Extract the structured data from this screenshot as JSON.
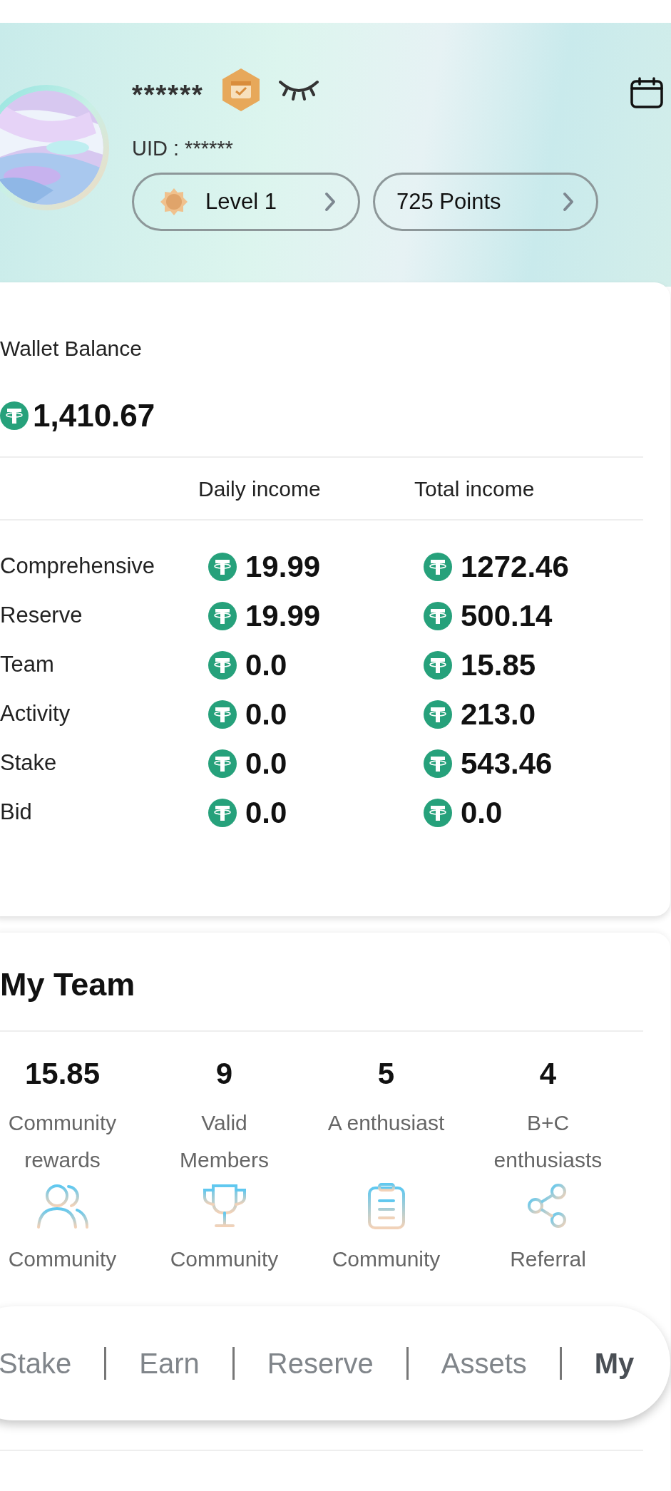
{
  "profile": {
    "name": "******",
    "uid": "UID : ******",
    "level": "Level 1",
    "points": "725 Points"
  },
  "wallet": {
    "title": "Wallet Balance",
    "balance": "1,410.67",
    "columns": [
      "Daily income",
      "Total income"
    ],
    "rows": [
      {
        "label": "Comprehensive",
        "daily": "19.99",
        "total": "1272.46"
      },
      {
        "label": "Reserve",
        "daily": "19.99",
        "total": "500.14"
      },
      {
        "label": "Team",
        "daily": "0.0",
        "total": "15.85"
      },
      {
        "label": "Activity",
        "daily": "0.0",
        "total": "213.0"
      },
      {
        "label": "Stake",
        "daily": "0.0",
        "total": "543.46"
      },
      {
        "label": "Bid",
        "daily": "0.0",
        "total": "0.0"
      }
    ]
  },
  "team": {
    "title": "My Team",
    "stats": [
      {
        "value": "15.85",
        "label": "Community\nrewards",
        "kind": "people"
      },
      {
        "value": "9",
        "label": "Valid\nMembers",
        "kind": "trophy"
      },
      {
        "value": "5",
        "label": "A enthusiast",
        "kind": "clipboard"
      },
      {
        "value": "4",
        "label": "B+C\nenthusiasts",
        "kind": "share"
      }
    ],
    "links": [
      "Community",
      "Community",
      "Community",
      "Referral"
    ]
  },
  "nav": [
    {
      "label": "Stake",
      "selected": false
    },
    {
      "label": "Earn",
      "selected": false
    },
    {
      "label": "Reserve",
      "selected": false
    },
    {
      "label": "Assets",
      "selected": false
    },
    {
      "label": "My",
      "selected": true
    }
  ]
}
